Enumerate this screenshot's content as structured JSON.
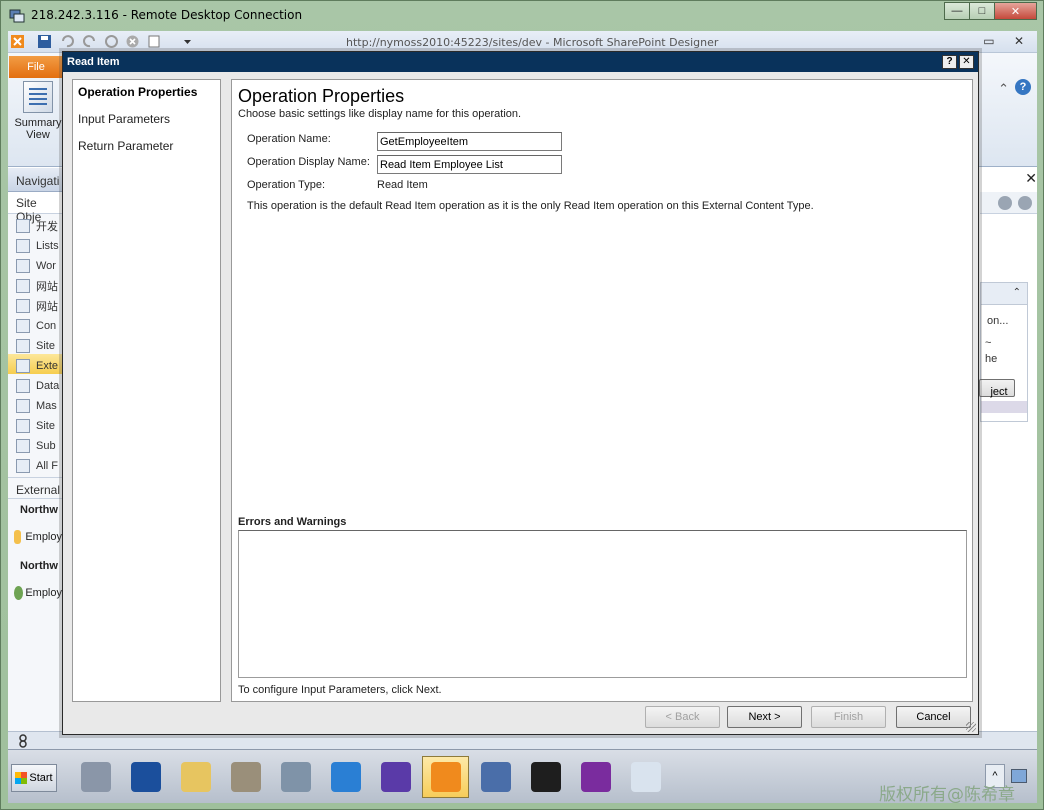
{
  "remote": {
    "title": "218.242.3.116 - Remote Desktop Connection",
    "minimize": "—",
    "maximize": "□",
    "close": "✕"
  },
  "spd": {
    "title": "http://nymoss2010:45223/sites/dev  -  Microsoft SharePoint Designer",
    "file_tab": "File",
    "summary_label": "Summary View",
    "win_controls": "▭ ✕",
    "ribbon_collapse": "⌃",
    "help": "?",
    "nav": {
      "header": "Navigati",
      "site_objects": "Site Obje",
      "items": [
        {
          "label": "开发",
          "icon": "home-icon"
        },
        {
          "label": "Lists",
          "icon": "list-icon"
        },
        {
          "label": "Wor",
          "icon": "workflow-icon"
        },
        {
          "label": "网站",
          "icon": "site-pages-icon"
        },
        {
          "label": "网站",
          "icon": "site-assets-icon"
        },
        {
          "label": "Con",
          "icon": "content-types-icon"
        },
        {
          "label": "Site",
          "icon": "site-columns-icon"
        },
        {
          "label": "Exte",
          "icon": "external-content-icon",
          "selected": true
        },
        {
          "label": "Data",
          "icon": "data-sources-icon"
        },
        {
          "label": "Mas",
          "icon": "master-pages-icon"
        },
        {
          "label": "Site",
          "icon": "site-groups-icon"
        },
        {
          "label": "Sub",
          "icon": "subsites-icon"
        },
        {
          "label": "All F",
          "icon": "all-files-icon"
        }
      ],
      "external_group": "External",
      "sections": [
        {
          "heading": "Northw",
          "row": "Employ"
        },
        {
          "heading": "Northw",
          "row": "Employ"
        }
      ]
    },
    "right_pane": {
      "close": "✕",
      "box_text1": "on...",
      "box_text2": "~",
      "box_text3": "he",
      "box_button": "ject",
      "collapse": "⌃"
    }
  },
  "dialog": {
    "title": "Read Item",
    "help_btn": "?",
    "close_btn": "✕",
    "steps": [
      "Operation Properties",
      "Input Parameters",
      "Return Parameter"
    ],
    "heading": "Operation Properties",
    "subheading": "Choose basic settings like display name for this operation.",
    "fields": {
      "name_label": "Operation Name:",
      "name_value": "GetEmployeeItem",
      "display_label": "Operation Display Name:",
      "display_value": "Read Item Employee List",
      "type_label": "Operation Type:",
      "type_value": "Read Item"
    },
    "note": "This operation is the default Read Item operation as it is the only Read Item operation on this External Content Type.",
    "errors_title": "Errors and Warnings",
    "hint": "To configure Input Parameters, click Next.",
    "buttons": {
      "back": "< Back",
      "next": "Next >",
      "finish": "Finish",
      "cancel": "Cancel"
    }
  },
  "taskbar": {
    "start": "Start",
    "icons": [
      "server-manager-icon",
      "powershell-icon",
      "explorer-icon",
      "tools-icon",
      "services-icon",
      "internet-explorer-icon",
      "visual-studio-icon",
      "sharepoint-designer-icon",
      "sql-server-icon",
      "command-prompt-icon",
      "visual-studio-2010-icon",
      "app-window-icon"
    ],
    "active_index": 7,
    "watermark": "版权所有@陈希章"
  }
}
